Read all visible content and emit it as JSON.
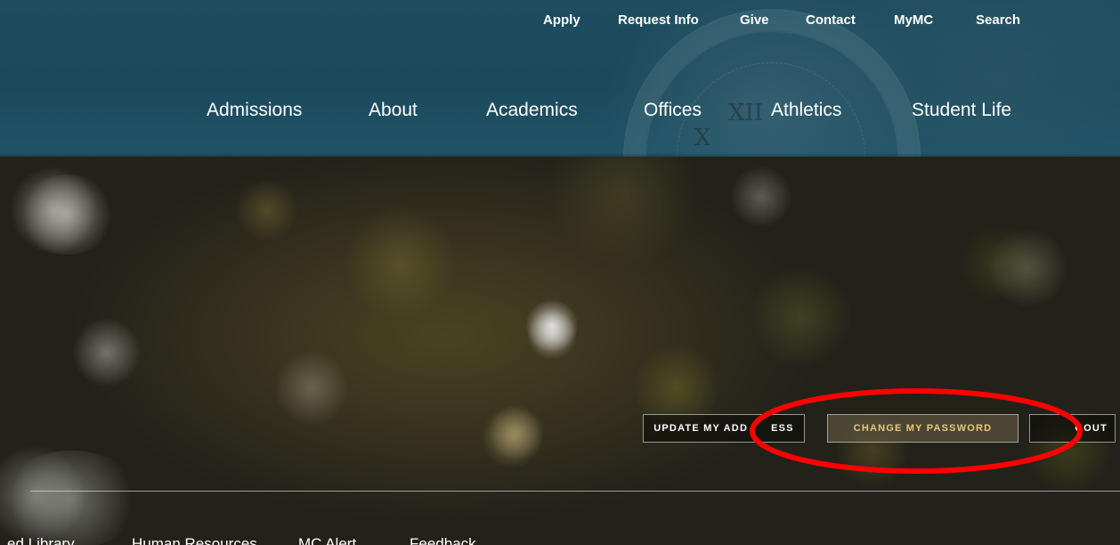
{
  "utility_nav": [
    "Apply",
    "Request Info",
    "Give",
    "Contact",
    "MyMC",
    "Search"
  ],
  "main_nav": [
    "Admissions",
    "About",
    "Academics",
    "Offices",
    "Athletics",
    "Student Life"
  ],
  "clock_numerals": [
    "XII",
    "X"
  ],
  "account_actions": {
    "update_address": "UPDATE MY ADD",
    "update_address_tail": "ESS",
    "change_password": "CHANGE MY PASSWORD",
    "logout": "GOUT"
  },
  "quick_links": [
    "ed Library",
    "Human Resources",
    "MC Alert",
    "Feedback"
  ],
  "colors": {
    "header_bg": "#1e4d60",
    "gold_text": "#e9c87a",
    "annotation_red": "#ff0000"
  }
}
